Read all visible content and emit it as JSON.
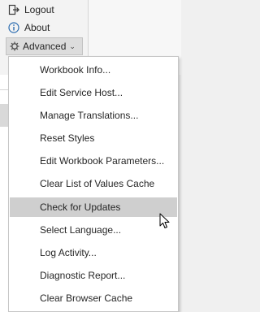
{
  "ribbon": {
    "logout_label": "Logout",
    "about_label": "About",
    "advanced_label": "Advanced",
    "logout_icon": "logout-icon",
    "about_icon": "info-icon",
    "advanced_icon": "gear-icon"
  },
  "menu": {
    "items": [
      {
        "label": "Workbook Info..."
      },
      {
        "label": "Edit Service Host..."
      },
      {
        "label": "Manage Translations..."
      },
      {
        "label": "Reset Styles"
      },
      {
        "label": "Edit Workbook Parameters..."
      },
      {
        "label": "Clear List of Values Cache"
      },
      {
        "label": "Check for Updates",
        "highlighted": true
      },
      {
        "label": "Select Language..."
      },
      {
        "label": "Log Activity..."
      },
      {
        "label": "Diagnostic Report..."
      },
      {
        "label": "Clear Browser Cache"
      }
    ]
  },
  "colors": {
    "highlight": "#cfcfcf",
    "about_icon": "#2b6cb0"
  }
}
